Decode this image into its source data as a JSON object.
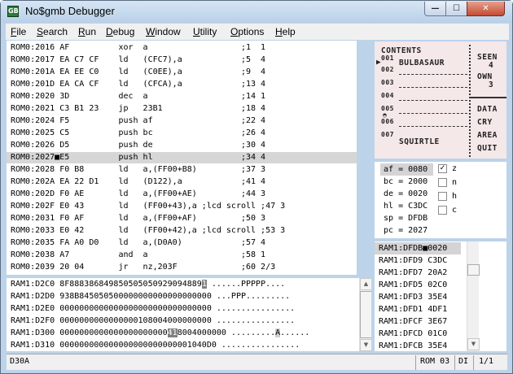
{
  "window": {
    "title": "No$gmb Debugger",
    "icon": "GB",
    "min": "—",
    "max": "☐",
    "close": "✕"
  },
  "menu": [
    {
      "key": "F",
      "rest": "ile"
    },
    {
      "key": "S",
      "rest": "earch"
    },
    {
      "key": "R",
      "rest": "un"
    },
    {
      "key": "D",
      "rest": "ebug"
    },
    {
      "key": "W",
      "rest": "indow"
    },
    {
      "key": "U",
      "rest": "tility"
    },
    {
      "key": "O",
      "rest": "ptions"
    },
    {
      "key": "H",
      "rest": "elp"
    }
  ],
  "disassembly": [
    "ROM0:2016 AF          xor  a                   ;1  1",
    "ROM0:2017 EA C7 CF    ld   (CFC7),a            ;5  4",
    "ROM0:201A EA EE C0    ld   (C0EE),a            ;9  4",
    "ROM0:201D EA CA CF    ld   (CFCA),a            ;13 4",
    "ROM0:2020 3D          dec  a                   ;14 1",
    "ROM0:2021 C3 B1 23    jp   23B1                ;18 4",
    "ROM0:2024 F5          push af                  ;22 4",
    "ROM0:2025 C5          push bc                  ;26 4",
    "ROM0:2026 D5          push de                  ;30 4",
    "ROM0:2027■E5          push hl                  ;34 4",
    "ROM0:2028 F0 B8       ld   a,(FF00+B8)         ;37 3",
    "ROM0:202A EA 22 D1    ld   (D122),a            ;41 4",
    "ROM0:202D F0 AE       ld   a,(FF00+AE)         ;44 3",
    "ROM0:202F E0 43       ld   (FF00+43),a ;lcd scroll ;47 3",
    "ROM0:2031 F0 AF       ld   a,(FF00+AF)         ;50 3",
    "ROM0:2033 E0 42       ld   (FF00+42),a ;lcd scroll ;53 3",
    "ROM0:2035 FA A0 D0    ld   a,(D0A0)            ;57 4",
    "ROM0:2038 A7          and  a                   ;58 1",
    "ROM0:2039 20 04       jr   nz,203F             ;60 2/3"
  ],
  "disasm_current_index": 9,
  "memory": [
    {
      "pre": "RAM1:D2C0 8F888386849850505050929094889",
      "cur": "1",
      "mid": " ......PPPPP",
      "curb": "",
      "post": "...."
    },
    {
      "pre": "RAM1:D2D0 938B84505050000000000000000000",
      "cur": "",
      "mid": "0 ...PPP.........",
      "curb": "",
      "post": ""
    },
    {
      "pre": "RAM1:D2E0 000000000000000000000000000000",
      "cur": "",
      "mid": "0 ................",
      "curb": "",
      "post": ""
    },
    {
      "pre": "RAM1:D2F0 000000000000000010800400000000",
      "cur": "",
      "mid": "0 ................",
      "curb": "",
      "post": ""
    },
    {
      "pre": "RAM1:D300 0000000000000000000000",
      "cur": "41",
      "mid": "8004000000 .........",
      "curb": "A",
      "post": "......"
    },
    {
      "pre": "RAM1:D310 000000000000000000000000001040D",
      "cur": "",
      "mid": "0 ................",
      "curb": "",
      "post": ""
    }
  ],
  "lcd": {
    "contents_label": "CONTENTS",
    "slots": [
      "001",
      "002",
      "003",
      "004",
      "005",
      "006",
      "007"
    ],
    "first_name": "BULBASAUR",
    "last_name": "SQUIRTLE",
    "seen_label": "SEEN",
    "seen_value": "4",
    "own_label": "OWN",
    "own_value": "3",
    "cursor": "▶",
    "ball": "◓",
    "menu": [
      "DATA",
      "CRY",
      "AREA",
      "QUIT"
    ]
  },
  "registers": [
    {
      "name": "af",
      "value": "0080"
    },
    {
      "name": "bc",
      "value": "2000"
    },
    {
      "name": "de",
      "value": "0020"
    },
    {
      "name": "hl",
      "value": "C3DC"
    },
    {
      "name": "sp",
      "value": "DFDB"
    },
    {
      "name": "pc",
      "value": "2027"
    }
  ],
  "flags": [
    {
      "name": "z",
      "checked": true,
      "mark": "✓"
    },
    {
      "name": "n",
      "checked": false,
      "mark": ""
    },
    {
      "name": "h",
      "checked": false,
      "mark": ""
    },
    {
      "name": "c",
      "checked": false,
      "mark": ""
    }
  ],
  "stack": [
    {
      "addr": "RAM1:DFDB",
      "value": "0020",
      "current": true
    },
    {
      "addr": "RAM1:DFD9",
      "value": "C3DC"
    },
    {
      "addr": "RAM1:DFD7",
      "value": "20A2"
    },
    {
      "addr": "RAM1:DFD5",
      "value": "02C0"
    },
    {
      "addr": "RAM1:DFD3",
      "value": "35E4"
    },
    {
      "addr": "RAM1:DFD1",
      "value": "4DF1"
    },
    {
      "addr": "RAM1:DFCF",
      "value": "3E67"
    },
    {
      "addr": "RAM1:DFCD",
      "value": "01C0"
    },
    {
      "addr": "RAM1:DFCB",
      "value": "35E4"
    }
  ],
  "scroll": {
    "up": "▲",
    "down": "▼"
  },
  "status": {
    "address": "D30A",
    "rom": "ROM 03",
    "mode": "DI",
    "page": "1/1"
  }
}
